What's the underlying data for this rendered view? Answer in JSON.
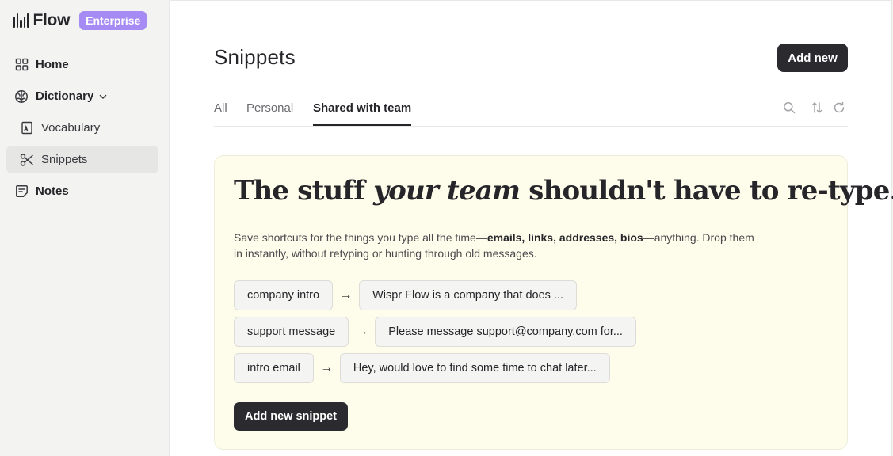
{
  "brand": {
    "name": "Flow",
    "badge": "Enterprise"
  },
  "sidebar": {
    "items": [
      {
        "label": "Home",
        "icon": "grid-icon"
      },
      {
        "label": "Dictionary",
        "icon": "brain-icon"
      },
      {
        "label": "Vocabulary",
        "icon": "book-icon"
      },
      {
        "label": "Snippets",
        "icon": "scissors-icon",
        "active": true
      },
      {
        "label": "Notes",
        "icon": "note-icon"
      }
    ]
  },
  "page": {
    "title": "Snippets",
    "add_button": "Add new"
  },
  "tabs": [
    {
      "label": "All"
    },
    {
      "label": "Personal"
    },
    {
      "label": "Shared with team",
      "active": true
    }
  ],
  "toolbar_icons": [
    "search-icon",
    "sort-icon",
    "refresh-icon"
  ],
  "promo": {
    "headline_before": "The stuff ",
    "headline_emph": "your team",
    "headline_after": " shouldn't have to re-type.",
    "desc_before": "Save shortcuts for the things you type all the time—",
    "desc_bold": "emails, links, addresses, bios",
    "desc_after": "—anything. Drop them in instantly, without retyping or hunting through old messages.",
    "arrow": "→",
    "examples": [
      {
        "trigger": "company intro",
        "expansion": "Wispr Flow is a company that does ..."
      },
      {
        "trigger": "support message",
        "expansion": "Please message support@company.com for..."
      },
      {
        "trigger": "intro email",
        "expansion": "Hey, would love to find some time to chat later..."
      }
    ],
    "add_button": "Add new snippet"
  },
  "colors": {
    "accent_badge": "#a78bf5",
    "primary_button": "#2b2a2f",
    "promo_background": "#fefdeb",
    "sidebar_background": "#f3f3f2"
  }
}
